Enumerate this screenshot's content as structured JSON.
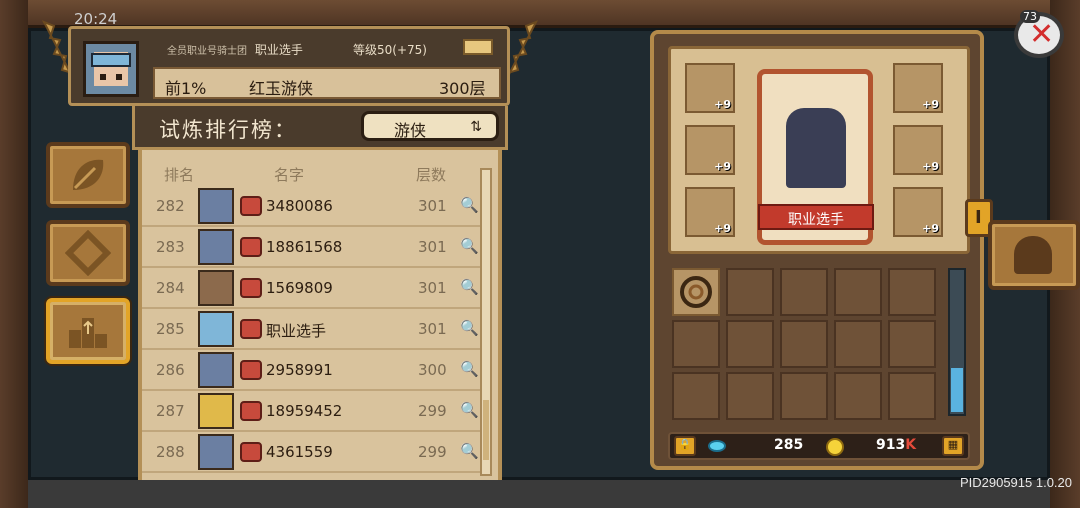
{
  "status_bar": {
    "time": "20:24"
  },
  "player": {
    "guild": "全员职业号骑士团",
    "name": "职业选手",
    "level": "等级50(+75)",
    "percentile": "前1%",
    "character": "红玉游侠",
    "floor": "300层"
  },
  "ranking": {
    "title": "试炼排行榜：",
    "class_filter": "游侠",
    "headers": {
      "rank": "排名",
      "name": "名字",
      "floors": "层数"
    },
    "rows": [
      {
        "rank": "282",
        "name": "3480086",
        "floors": "301"
      },
      {
        "rank": "283",
        "name": "18861568",
        "floors": "301"
      },
      {
        "rank": "284",
        "name": "1569809",
        "floors": "301"
      },
      {
        "rank": "285",
        "name": "职业选手",
        "floors": "301"
      },
      {
        "rank": "286",
        "name": "2958991",
        "floors": "300"
      },
      {
        "rank": "287",
        "name": "18959452",
        "floors": "299"
      },
      {
        "rank": "288",
        "name": "4361559",
        "floors": "299"
      }
    ]
  },
  "equipment": {
    "hero_label": "职业选手",
    "slots_left": [
      {
        "icon": "skull-helmet-icon",
        "plus": "+9"
      },
      {
        "icon": "ring-icon",
        "plus": "+9"
      },
      {
        "icon": "bracelet-icon",
        "plus": "+9"
      }
    ],
    "slots_right": [
      {
        "icon": "skull-armor-icon",
        "plus": "+9"
      },
      {
        "icon": "amulet-icon",
        "plus": "+9"
      },
      {
        "icon": "gauntlet-icon",
        "plus": "+9"
      }
    ],
    "side_marker": "I"
  },
  "currency": {
    "gems": "285",
    "coins": "913",
    "coins_unit": "K"
  },
  "close_badge": "73",
  "version": "PID2905915 1.0.20"
}
